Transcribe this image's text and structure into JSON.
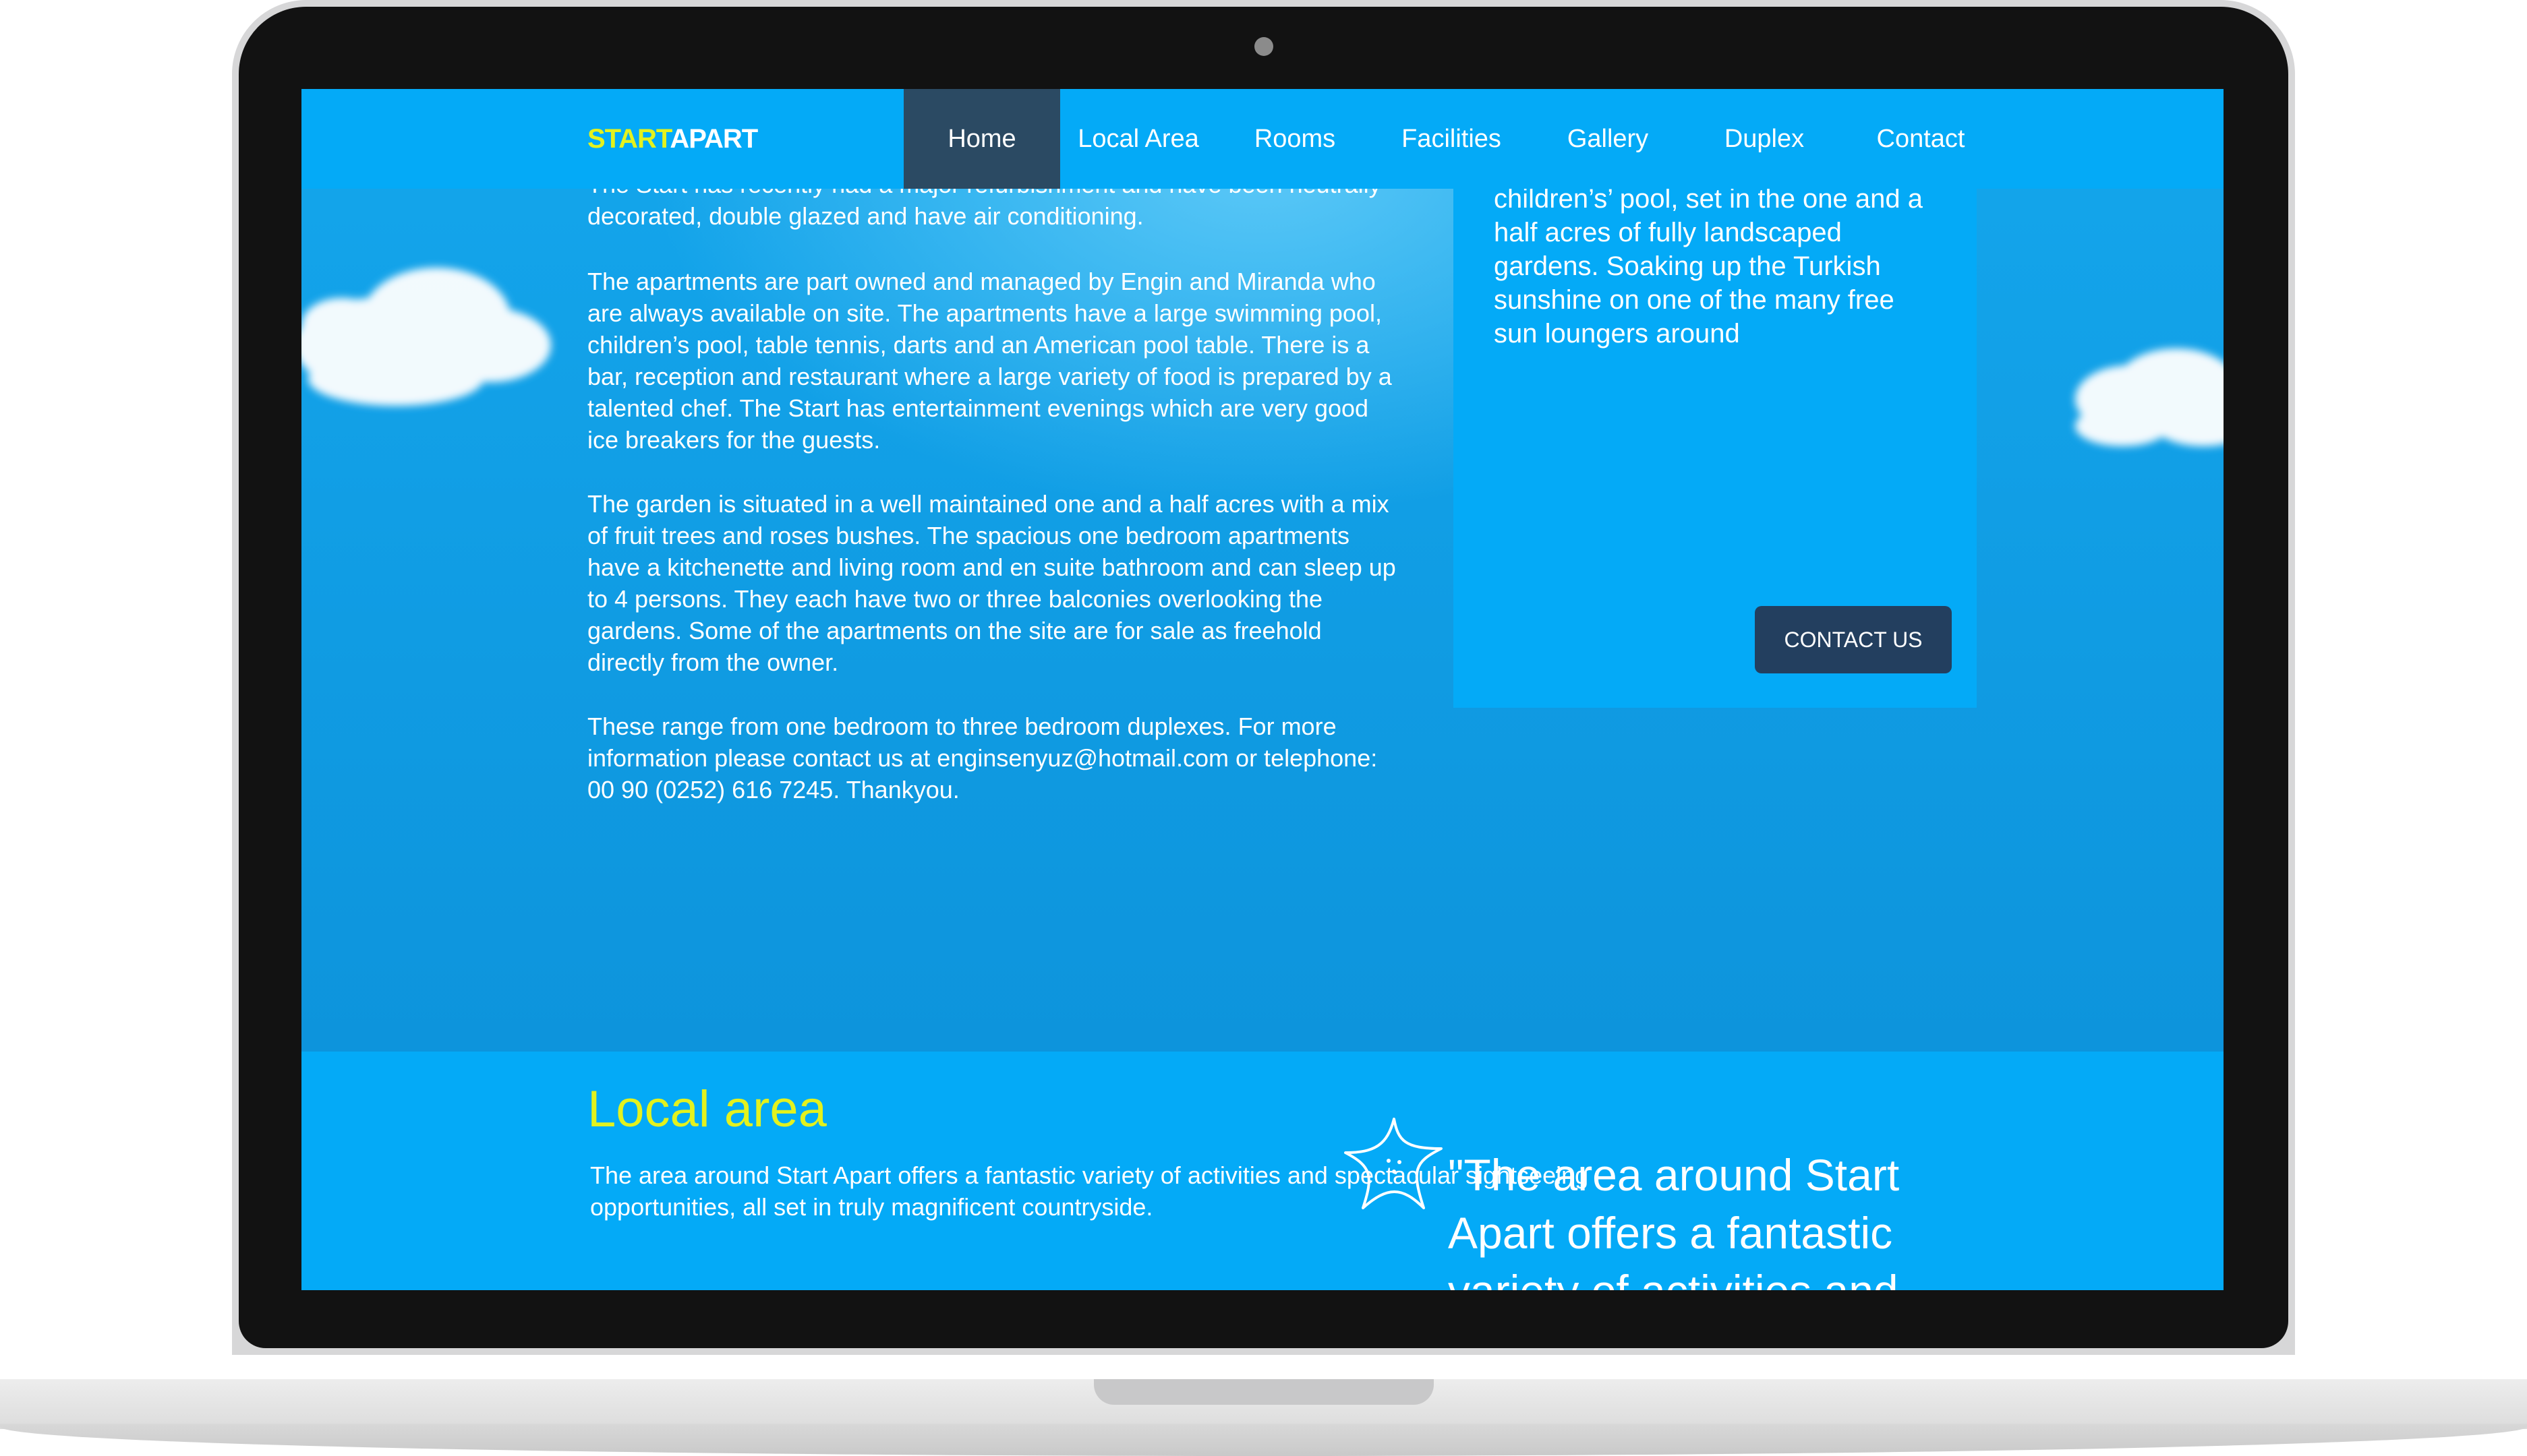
{
  "nav": {
    "logo_part1": "START",
    "logo_part2": "APART",
    "items": [
      "Home",
      "Local Area",
      "Rooms",
      "Facilities",
      "Gallery",
      "Duplex",
      "Contact"
    ],
    "active": "Home"
  },
  "intro": {
    "p0": "The Start has recently had a major refurbishment and have been neutrally decorated, double glazed and have air conditioning.",
    "p1": "The apartments are part owned and managed by Engin and Miranda who are always available on site. The apartments have a large swimming pool, children’s pool, table tennis, darts and an American pool table. There is a bar, reception and restaurant where a large variety of food is prepared by a talented chef. The Start has entertainment evenings which are very good ice breakers for the guests.",
    "p2": "The garden is situated in a well maintained one and a half acres with a mix of fruit trees and roses bushes. The spacious one bedroom apartments have a kitchenette and living room and en suite bathroom and can sleep up to 4 persons. They each have two or three balconies overlooking the gardens. Some of the apartments on the site are for sale as freehold directly from the owner.",
    "p3": "These range from one bedroom to three bedroom duplexes. For more information please contact us at enginsenyuz@hotmail.com or telephone: 00 90 (0252) 616 7245. Thankyou."
  },
  "card": {
    "text": "children’s’ pool, set in the one and a half acres of fully landscaped gardens. Soaking up the Turkish sunshine on one of the many free sun loungers around",
    "button": "CONTACT US"
  },
  "local_area": {
    "title": "Local area",
    "text": "The area around Start Apart offers a fantastic variety of activities and spectacular sightseeing opportunities, all set in truly magnificent countryside.",
    "quote": "\"The area around Start Apart offers a fantastic variety of activities and"
  },
  "colors": {
    "sky": "#14a6ec",
    "panel": "#04aaf7",
    "accent_yellow": "#e3f21e",
    "nav_active": "#2b4a63",
    "button": "#233f5f"
  },
  "icons": [
    "cloud-left-icon",
    "cloud-right-icon",
    "starfish-icon",
    "camera-icon"
  ]
}
